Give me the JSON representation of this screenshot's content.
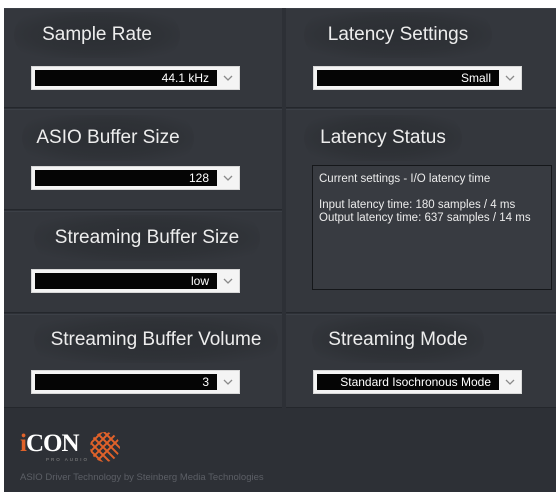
{
  "sample_rate": {
    "title": "Sample Rate",
    "value": "44.1 kHz"
  },
  "latency_settings": {
    "title": "Latency Settings",
    "value": "Small"
  },
  "asio_buffer_size": {
    "title": "ASIO Buffer Size",
    "value": "128"
  },
  "latency_status": {
    "title": "Latency Status",
    "line1": "Current settings - I/O latency time",
    "line2": "Input latency time: 180 samples / 4 ms",
    "line3": "Output latency time: 637 samples / 14 ms"
  },
  "streaming_buffer_size": {
    "title": "Streaming Buffer Size",
    "value": "low"
  },
  "streaming_buffer_volume": {
    "title": "Streaming Buffer Volume",
    "value": "3"
  },
  "streaming_mode": {
    "title": "Streaming Mode",
    "value": "Standard Isochronous Mode"
  },
  "footer": {
    "logo_i": "i",
    "logo_rest": "CON",
    "logo_sub": "PRO AUDIO",
    "credit": "ASIO Driver Technology by Steinberg Media Technologies"
  },
  "colors": {
    "background": "#2d3036",
    "panel": "#34373d",
    "accent": "#e0622a"
  }
}
